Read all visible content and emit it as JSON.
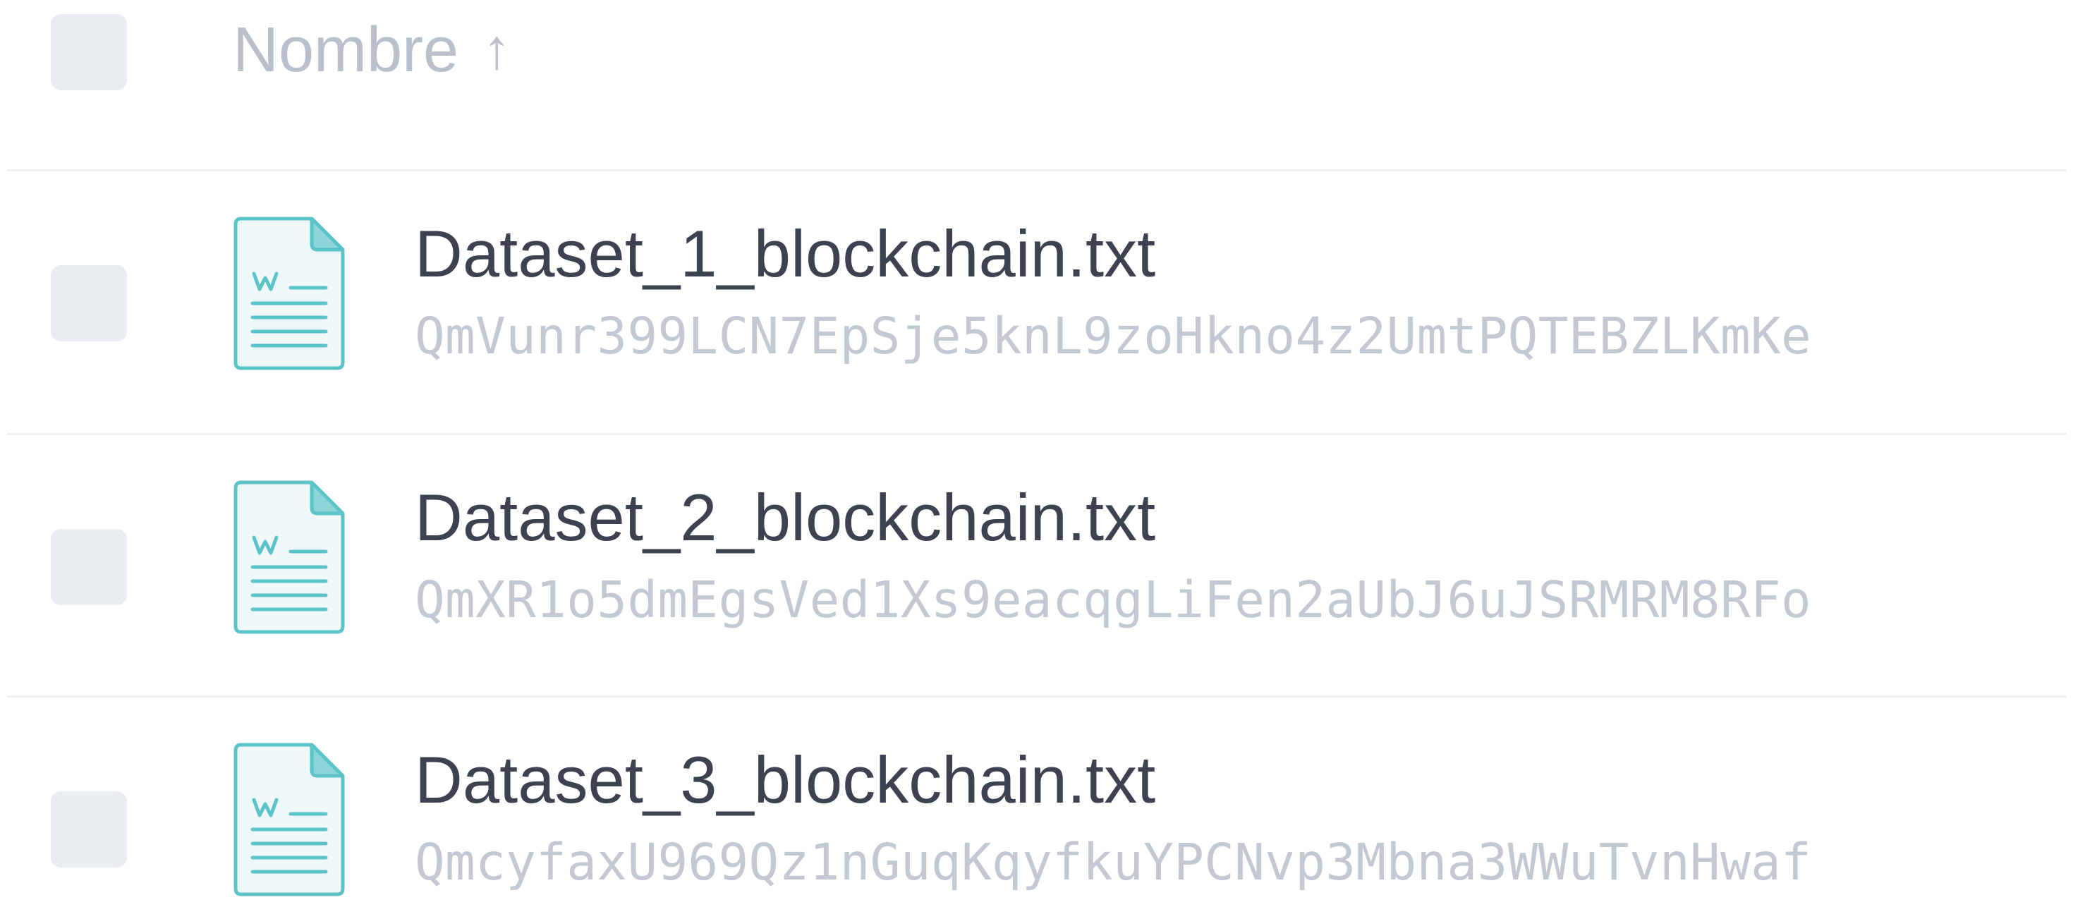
{
  "header": {
    "column_label": "Nombre",
    "sort_icon": "arrow-up-icon",
    "sort_glyph": "↑"
  },
  "files": [
    {
      "name": "Dataset_1_blockchain.txt",
      "hash": "QmVunr399LCN7EpSje5knL9zoHkno4z2UmtPQTEBZLKmKe",
      "icon": "word-document-icon"
    },
    {
      "name": "Dataset_2_blockchain.txt",
      "hash": "QmXR1o5dmEgsVed1Xs9eacqgLiFen2aUbJ6uJSRMRM8RFo",
      "icon": "word-document-icon"
    },
    {
      "name": "Dataset_3_blockchain.txt",
      "hash": "QmcyfaxU969Qz1nGuqKqyfkuYPCNvp3Mbna3WWuTvnHwaf",
      "icon": "word-document-icon"
    }
  ],
  "colors": {
    "icon_stroke": "#5cc4c8",
    "icon_fill": "#eef8f8",
    "icon_fold": "#8dd5d8",
    "checkbox_bg": "#e9edf2",
    "name_text": "#3d4250",
    "hash_text": "#c3c9d3",
    "header_text": "#b9c0cb"
  }
}
